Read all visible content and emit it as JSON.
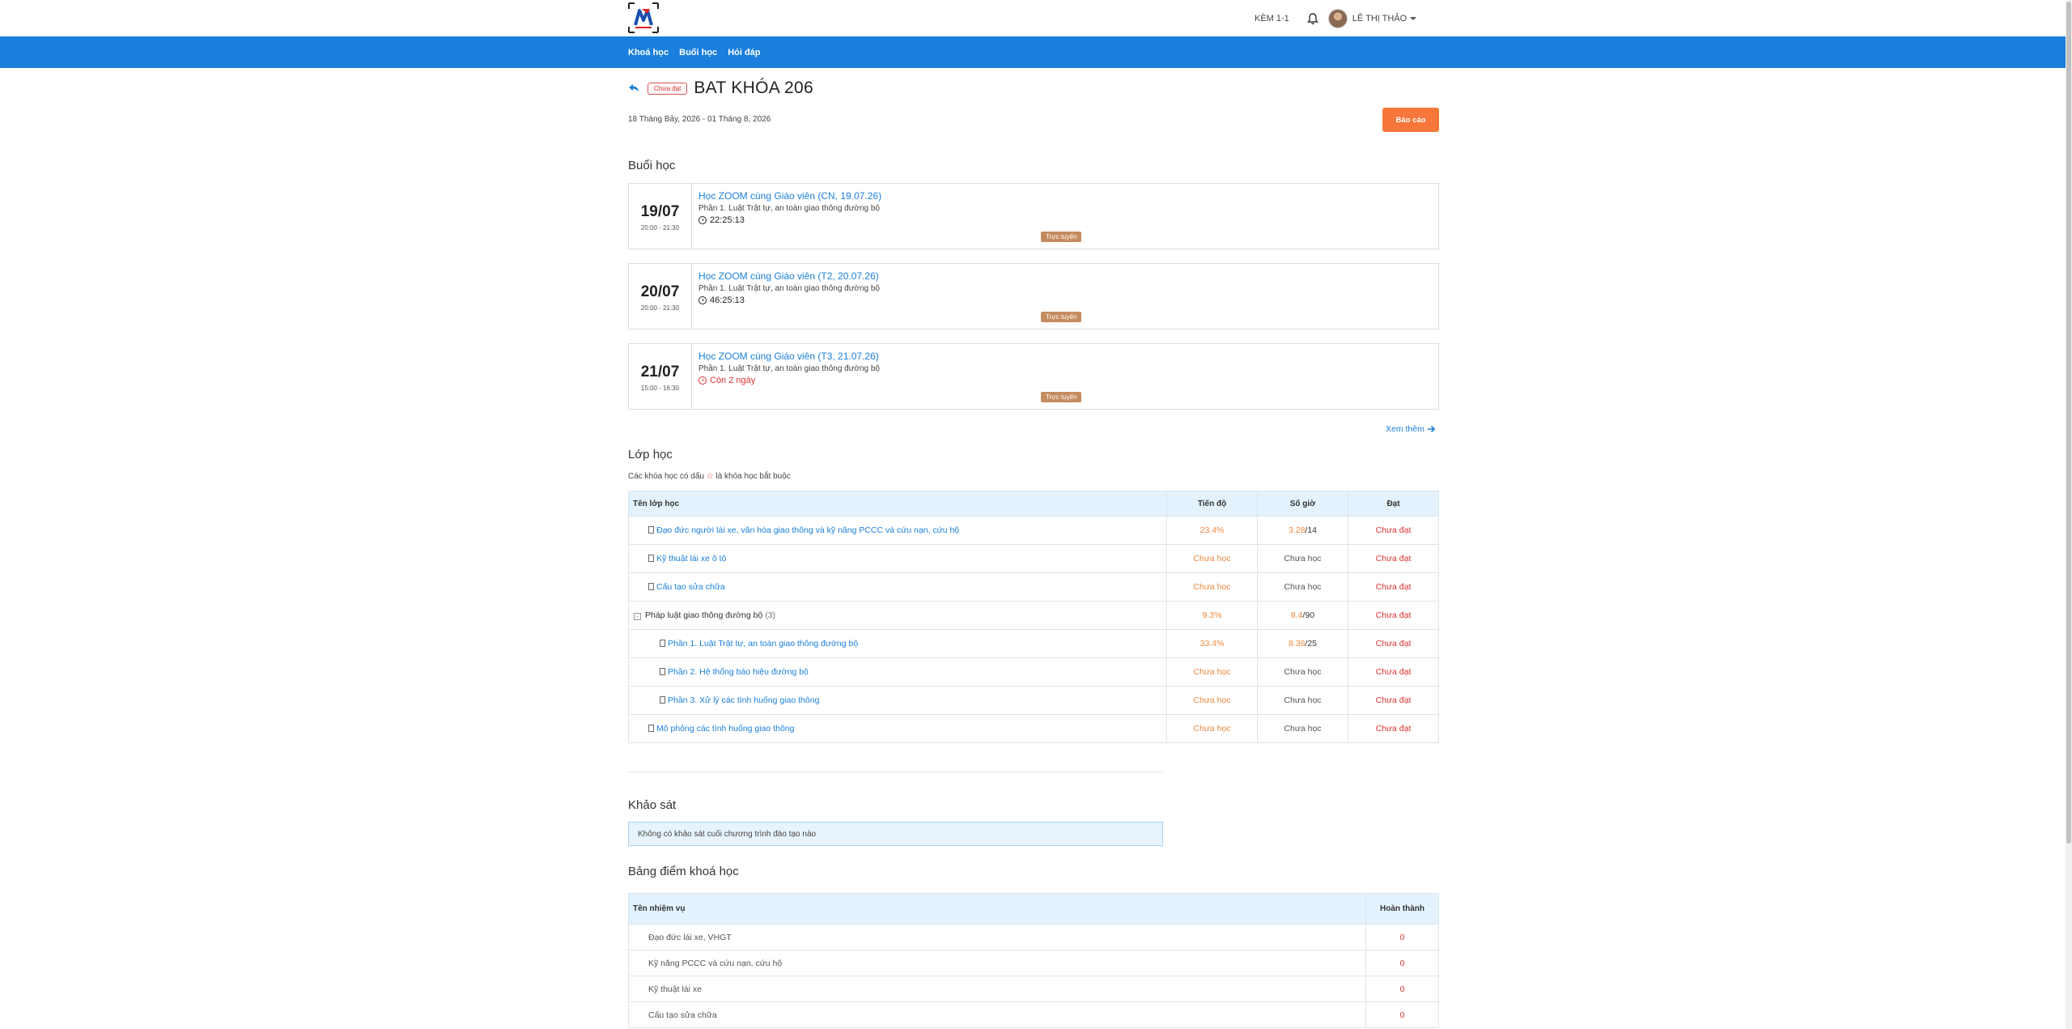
{
  "header": {
    "kem_label": "KÈM 1-1",
    "user_name": "LÊ THỊ THẢO",
    "brand_color": "#1a7fdc"
  },
  "nav": {
    "items": [
      {
        "label": "Khoá học"
      },
      {
        "label": "Buổi học"
      },
      {
        "label": "Hỏi đáp"
      }
    ]
  },
  "course": {
    "status_badge": "Chưa đạt",
    "title": "BAT KHÓA 206",
    "date_range": "18 Tháng Bảy, 2026 - 01 Tháng 8, 2026",
    "report_button": "Báo cáo"
  },
  "sessions_section": {
    "title": "Buổi học",
    "see_more": "Xem thêm",
    "items": [
      {
        "day": "19/07",
        "time": "20:00 - 21:30",
        "title": "Học ZOOM cùng Giáo viên (CN, 19.07.26)",
        "subtitle": "Phần 1. Luật Trật tự, an toàn giao thông đường bộ",
        "countdown": "22:25:13",
        "tag": "Trực tuyến"
      },
      {
        "day": "20/07",
        "time": "20:00 - 21:30",
        "title": "Học ZOOM cùng Giáo viên (T2, 20.07.26)",
        "subtitle": "Phần 1. Luật Trật tự, an toàn giao thông đường bộ",
        "countdown": "46:25:13",
        "tag": "Trực tuyến"
      },
      {
        "day": "21/07",
        "time": "15:00 - 16:30",
        "title": "Học ZOOM cùng Giáo viên (T3, 21.07.26)",
        "subtitle": "Phần 1. Luật Trật tự, an toàn giao thông đường bộ",
        "countdown": "Còn 2 ngày",
        "tag": "Trực tuyến"
      }
    ]
  },
  "classes_section": {
    "title": "Lớp học",
    "note_before": "Các khóa học có dấu",
    "note_star": "☆",
    "note_after": "là khóa học bắt buộc",
    "columns": {
      "name": "Tên lớp học",
      "progress": "Tiến độ",
      "hours": "Số giờ",
      "pass": "Đạt"
    },
    "rows": [
      {
        "name": "Đạo đức người lái xe, văn hóa giao thông và kỹ năng PCCC và cứu nạn, cứu hộ",
        "progress": "23.4%",
        "hours_done": "3.28",
        "hours_total": "/14",
        "pass": "Chưa đạt"
      },
      {
        "name": "Kỹ thuật lái xe ô tô",
        "progress": "Chưa học",
        "hours_text": "Chưa học",
        "pass": "Chưa đạt"
      },
      {
        "name": "Cấu tạo sửa chữa",
        "progress": "Chưa học",
        "hours_text": "Chưa học",
        "pass": "Chưa đạt"
      },
      {
        "name": "Pháp luật giao thông đường bộ",
        "count": "(3)",
        "progress": "9.3%",
        "hours_done": "8.4",
        "hours_total": "/90",
        "pass": "Chưa đạt"
      },
      {
        "name": "Phần 1. Luật Trật tự, an toàn giao thông đường bộ",
        "progress": "33.4%",
        "hours_done": "8.36",
        "hours_total": "/25",
        "pass": "Chưa đạt"
      },
      {
        "name": "Phần 2. Hệ thống báo hiệu đường bộ",
        "progress": "Chưa học",
        "hours_text": "Chưa học",
        "pass": "Chưa đạt"
      },
      {
        "name": "Phần 3. Xử lý các tình huống giao thông",
        "progress": "Chưa học",
        "hours_text": "Chưa học",
        "pass": "Chưa đạt"
      },
      {
        "name": "Mô phỏng các tình huống giao thông",
        "progress": "Chưa học",
        "hours_text": "Chưa học",
        "pass": "Chưa đạt"
      }
    ]
  },
  "survey_section": {
    "title": "Khảo sát",
    "empty_message": "Không có khảo sát cuối chương trình đào tạo nào"
  },
  "scores_section": {
    "title": "Bảng điểm khoá học",
    "columns": {
      "task": "Tên nhiệm vụ",
      "done": "Hoàn thành"
    },
    "rows": [
      {
        "task": "Đạo đức lái xe, VHGT",
        "done": "0"
      },
      {
        "task": "Kỹ năng PCCC và cứu nạn, cứu hộ",
        "done": "0"
      },
      {
        "task": "Kỹ thuật lái xe",
        "done": "0"
      },
      {
        "task": "Cấu tạo sửa chữa",
        "done": "0"
      }
    ]
  }
}
